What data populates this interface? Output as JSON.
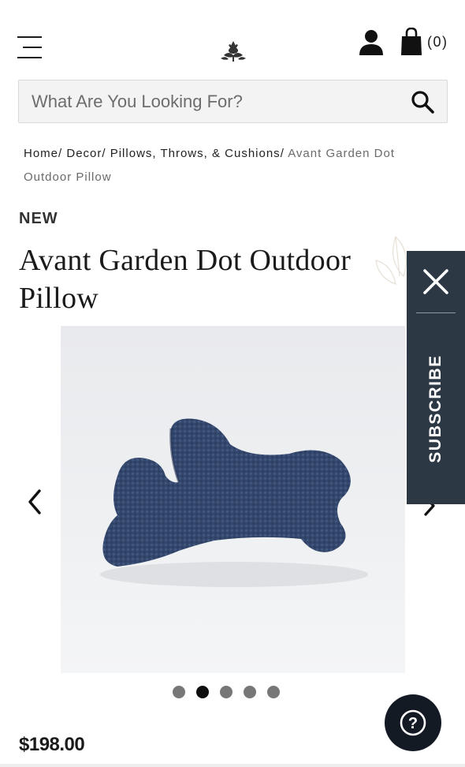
{
  "header": {
    "cart_count": "(0)"
  },
  "search": {
    "placeholder": "What Are You Looking For?"
  },
  "breadcrumb": {
    "items": [
      "Home",
      "Decor",
      "Pillows, Throws, & Cushions"
    ],
    "separator": "/",
    "current": "Avant Garden Dot Outdoor Pillow"
  },
  "product": {
    "badge": "NEW",
    "title": "Avant Garden Dot Outdoor Pillow",
    "price": "$198.00",
    "gallery": {
      "image_count": 5,
      "active_index": 1,
      "subject": "navy blue textured dog-shaped outdoor pillow"
    }
  },
  "subscribe": {
    "label": "SUBSCRIBE"
  },
  "help": {
    "label": "?"
  },
  "colors": {
    "panel": "#2d3845",
    "help_button": "#131a23",
    "pillow": "#34486e",
    "dot_active": "#0e0e0e",
    "dot_inactive": "#777777"
  }
}
